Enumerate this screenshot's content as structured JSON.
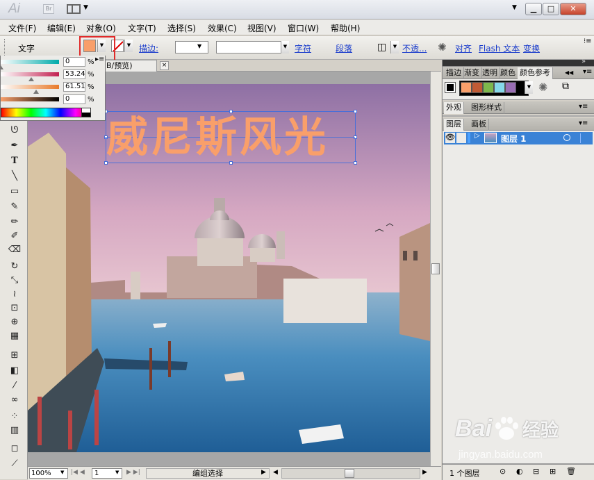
{
  "app": {
    "logo_text": "Ai",
    "bridge_text": "Br",
    "title_arrow": "▼"
  },
  "window_buttons": {
    "minimize": "▁",
    "maximize": "□",
    "close": "✕"
  },
  "menu": [
    "文件(F)",
    "编辑(E)",
    "对象(O)",
    "文字(T)",
    "选择(S)",
    "效果(C)",
    "视图(V)",
    "窗口(W)",
    "帮助(H)"
  ],
  "control_bar": {
    "selection_type": "文字",
    "fill_color": "#f99f6a",
    "stroke_label": "描边:",
    "links": [
      "字符",
      "段落",
      "不透...",
      "对齐",
      "Flash 文本",
      "变换"
    ]
  },
  "color_popup": {
    "values": [
      "0",
      "53.24",
      "61.51",
      "0"
    ],
    "slider_levels": [
      0,
      0.5324,
      0.6151,
      0
    ],
    "pct": "%"
  },
  "document": {
    "tab_label": "B/预览)",
    "close": "×",
    "headline": "威尼斯风光",
    "headline_color": "#f99f6a"
  },
  "status": {
    "zoom": "100%",
    "page": "1",
    "selection_label": "编组选择"
  },
  "panels": {
    "tabs_row1": [
      "描边",
      "渐变",
      "透明",
      "颜色",
      "颜色参考"
    ],
    "harmony_colors": [
      "#f99f6a",
      "#c05a34",
      "#7db84c",
      "#86d8ea",
      "#9a6eb4"
    ],
    "tabs_row2": [
      "外观",
      "图形样式"
    ],
    "tabs_row3": [
      "图层",
      "画板"
    ],
    "layer_name": "图层 1",
    "layer_count": "1 个图层"
  },
  "watermark": {
    "brand": "Bai",
    "brand2": "经验",
    "url": "jingyan.baidu.com"
  }
}
